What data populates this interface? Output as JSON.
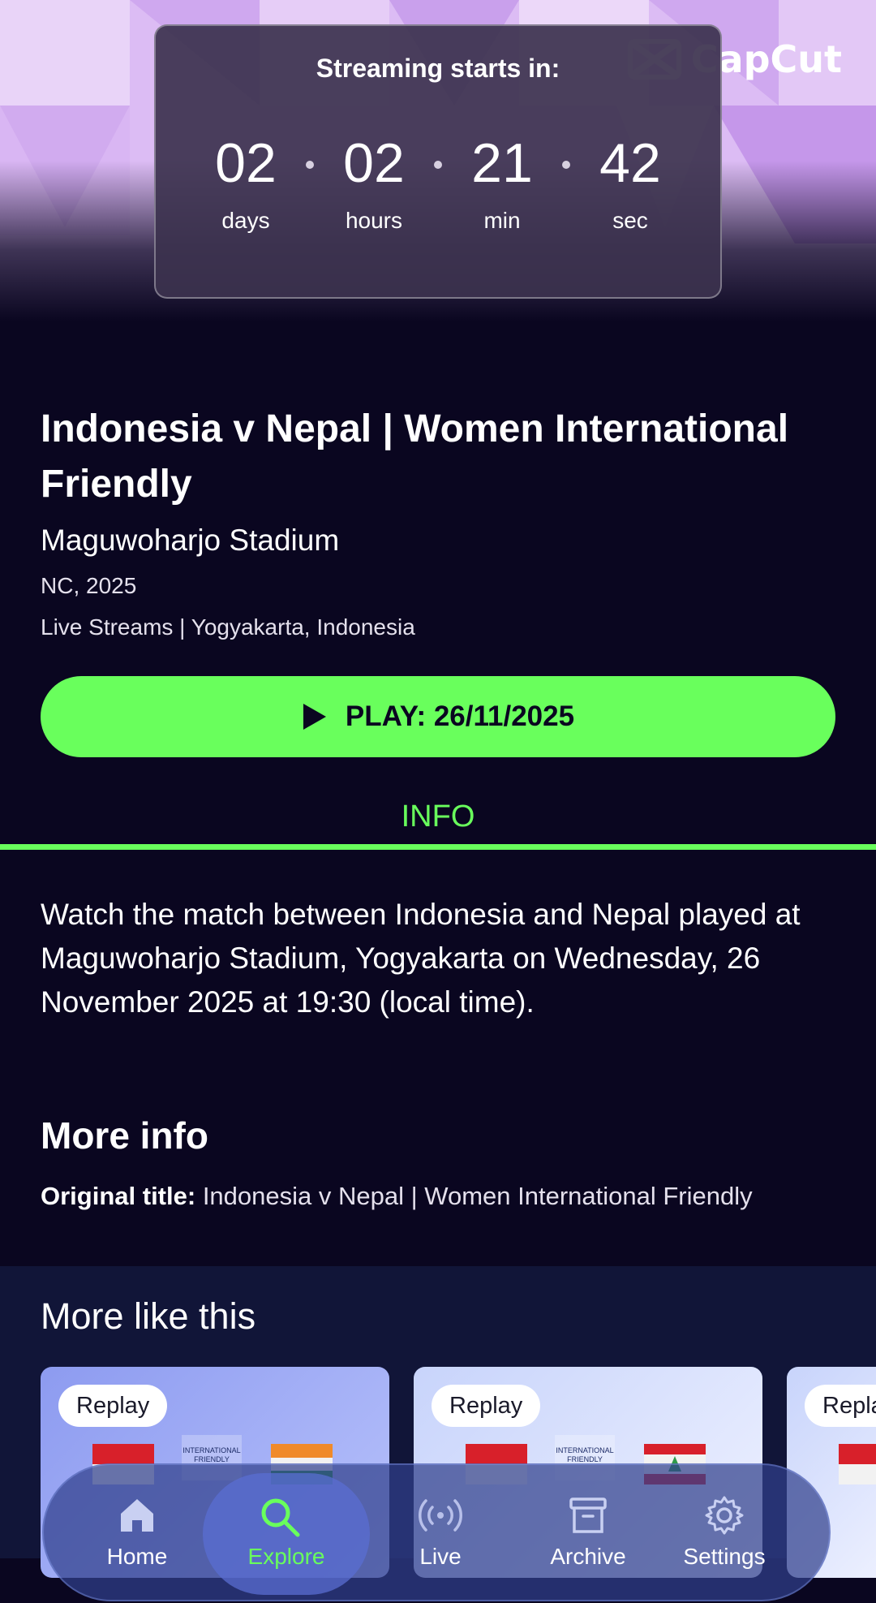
{
  "brand": {
    "logo_text": "CapCut"
  },
  "countdown": {
    "title": "Streaming starts in:",
    "units": [
      {
        "value": "02",
        "label": "days"
      },
      {
        "value": "02",
        "label": "hours"
      },
      {
        "value": "21",
        "label": "min"
      },
      {
        "value": "42",
        "label": "sec"
      }
    ]
  },
  "event": {
    "title": "Indonesia v Nepal | Women International Friendly",
    "venue": "Maguwoharjo Stadium",
    "season": "NC, 2025",
    "meta": "Live Streams | Yogyakarta, Indonesia",
    "play_label": "PLAY: 26/11/2025"
  },
  "tabs": {
    "info_label": "INFO"
  },
  "description": "Watch the match between Indonesia and Nepal played at Maguwoharjo Stadium, Yogyakarta on Wednesday, 26 November 2025 at 19:30 (local time).",
  "more_info": {
    "heading": "More info",
    "original_title_label": "Original title:",
    "original_title_value": "Indonesia v Nepal | Women International Friendly"
  },
  "more_like_this": {
    "heading": "More like this",
    "cards": [
      {
        "badge": "Replay",
        "friendly_text": "INTERNATIONAL FRIENDLY"
      },
      {
        "badge": "Replay",
        "friendly_text": "INTERNATIONAL FRIENDLY"
      },
      {
        "badge": "Replay"
      }
    ]
  },
  "nav": {
    "items": [
      {
        "label": "Home",
        "icon": "home-icon"
      },
      {
        "label": "Explore",
        "icon": "search-icon",
        "active": true
      },
      {
        "label": "Live",
        "icon": "broadcast-icon"
      },
      {
        "label": "Archive",
        "icon": "archive-icon"
      },
      {
        "label": "Settings",
        "icon": "gear-icon"
      }
    ]
  },
  "colors": {
    "accent": "#69ff5c",
    "background": "#0a0620",
    "panel": "#111538",
    "hero": "#d9b8f2"
  }
}
